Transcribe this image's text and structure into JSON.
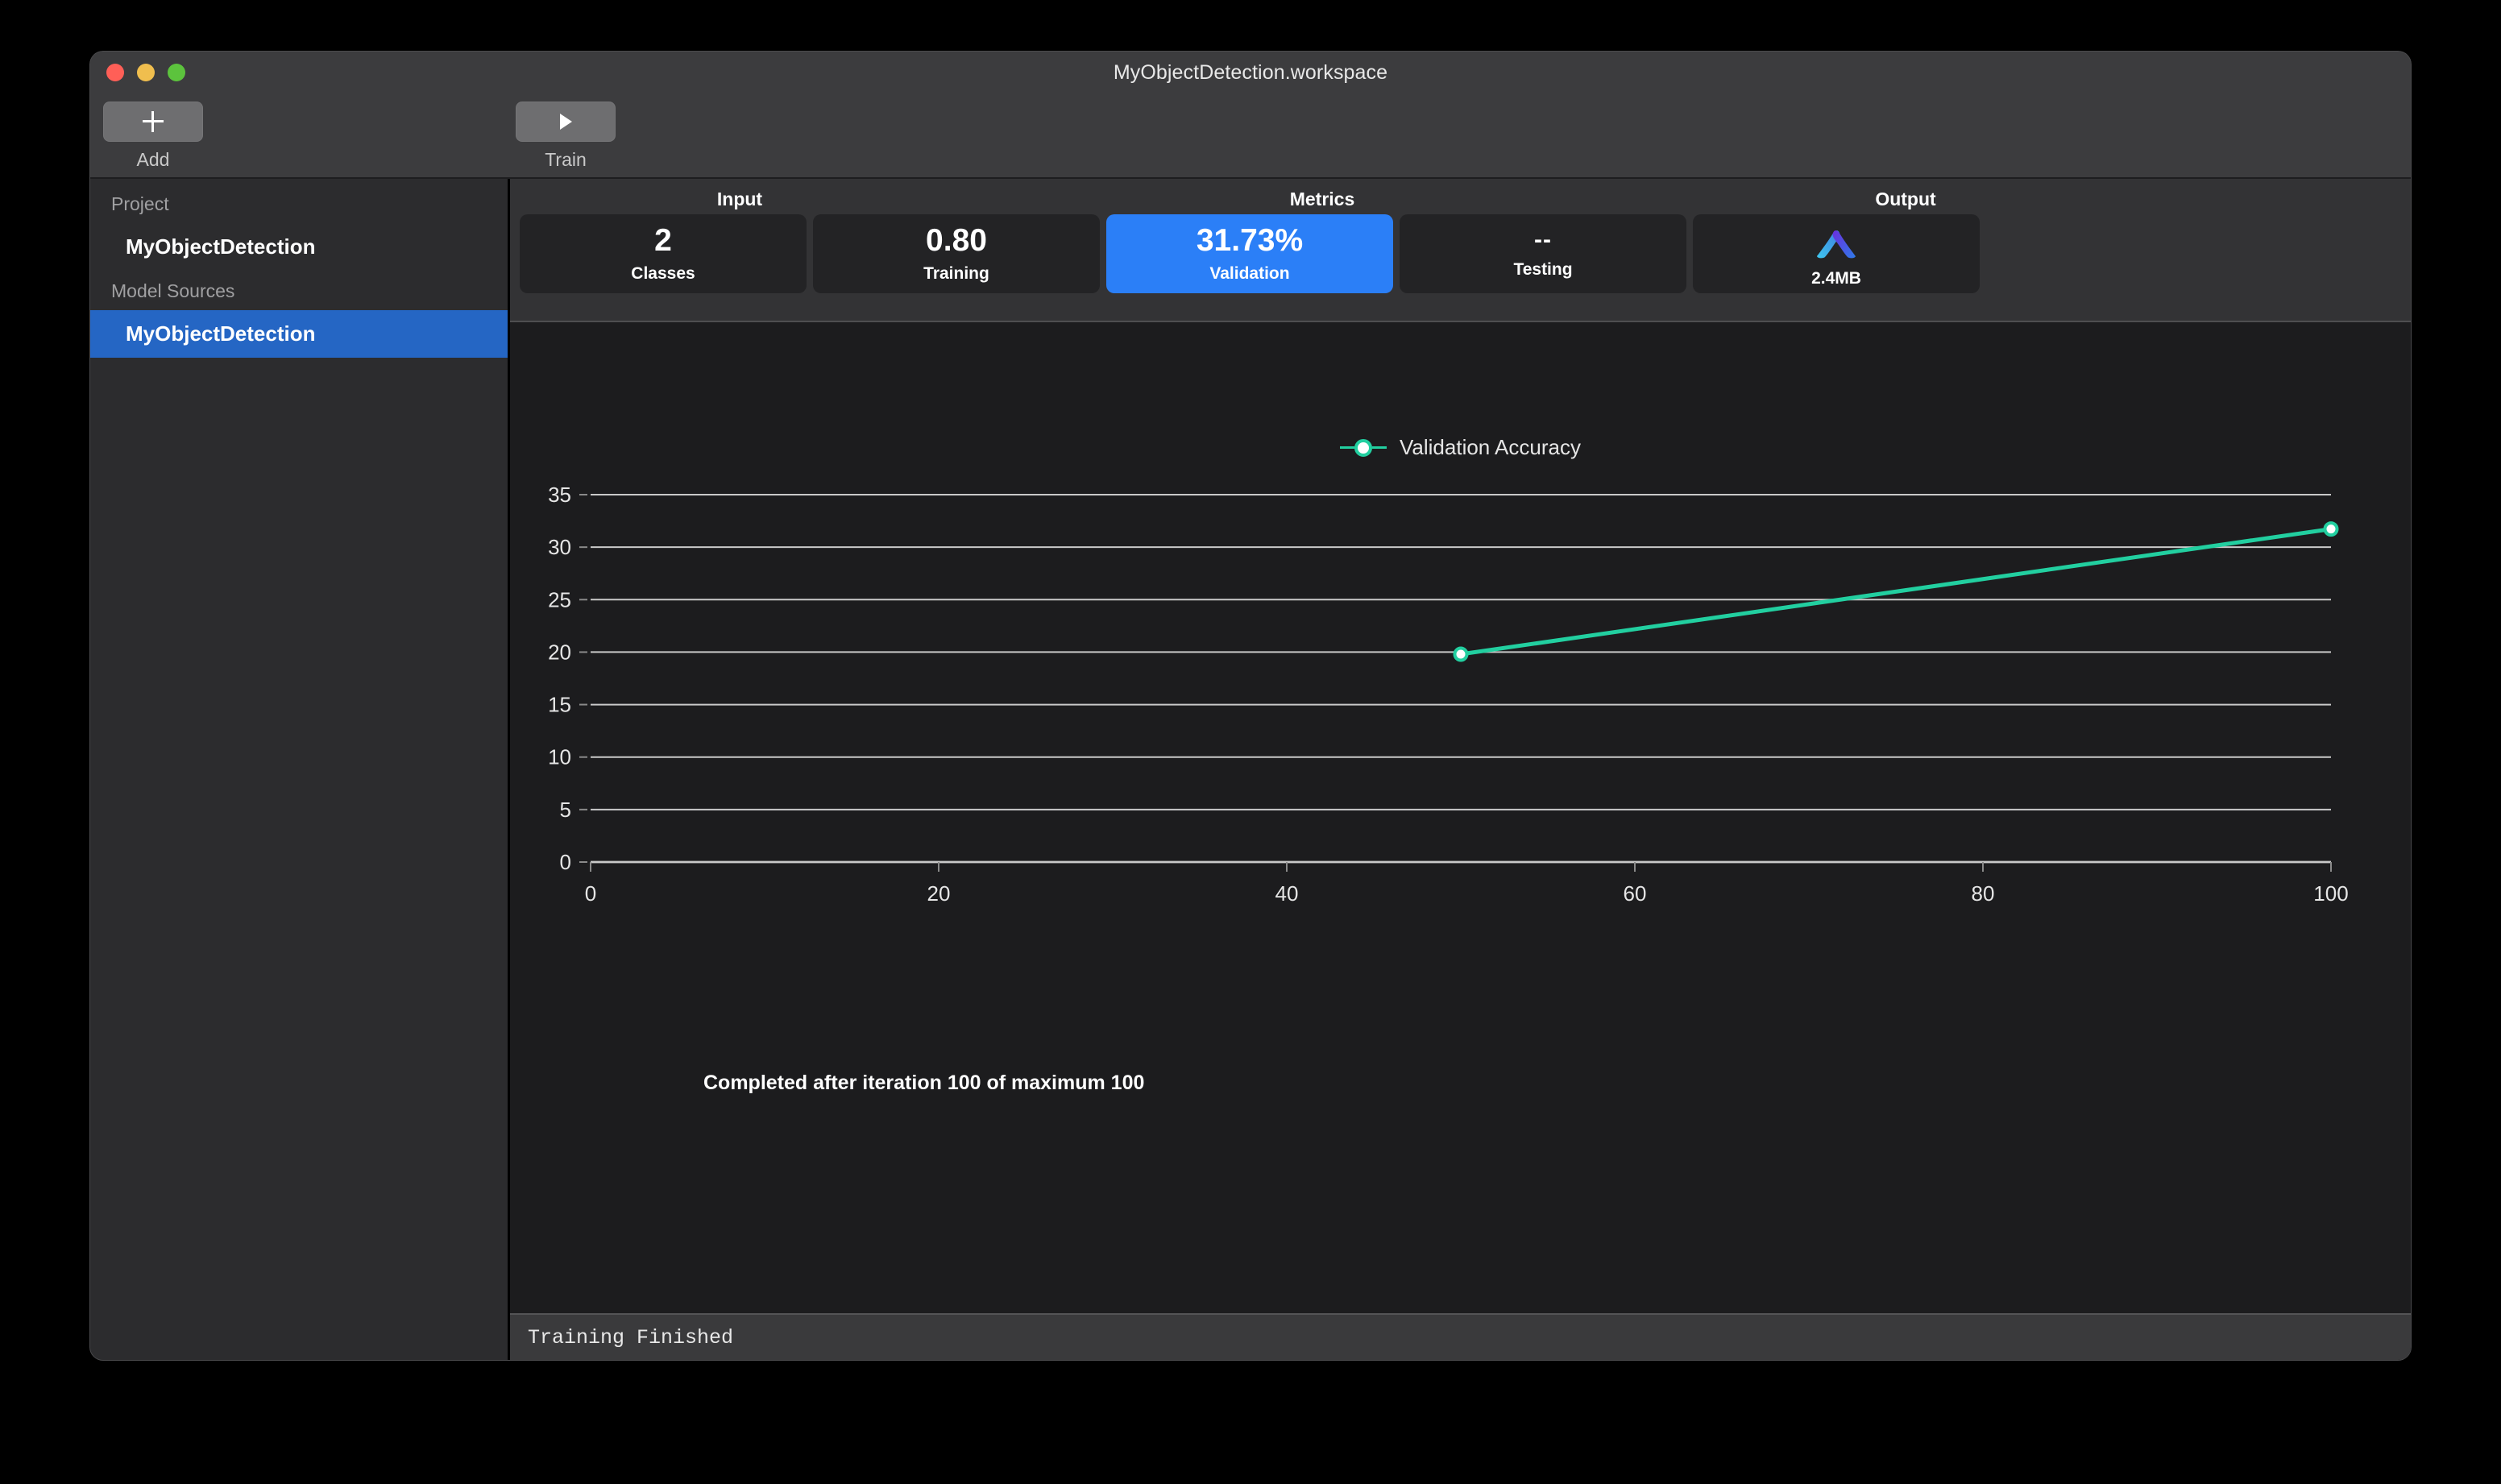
{
  "window": {
    "title": "MyObjectDetection.workspace",
    "traffic_lights": [
      "close",
      "minimize",
      "zoom"
    ]
  },
  "toolbar": {
    "items": [
      {
        "label": "Add",
        "icon": "plus-icon"
      },
      {
        "label": "Train",
        "icon": "play-icon"
      }
    ]
  },
  "sidebar": {
    "sections": [
      {
        "header": "Project",
        "items": [
          {
            "label": "MyObjectDetection",
            "selected": false
          }
        ]
      },
      {
        "header": "Model Sources",
        "items": [
          {
            "label": "MyObjectDetection",
            "selected": true
          }
        ]
      }
    ]
  },
  "metrics_header": {
    "groups": [
      {
        "title": "Input"
      },
      {
        "title": "Metrics"
      },
      {
        "title": "Output"
      }
    ],
    "cards": [
      {
        "value": "2",
        "label": "Classes",
        "accent": false
      },
      {
        "value": "0.80",
        "label": "Training",
        "accent": false
      },
      {
        "value": "31.73%",
        "label": "Validation",
        "accent": true
      },
      {
        "value": "--",
        "label": "Testing",
        "accent": false
      },
      {
        "value": "2.4MB",
        "label": "",
        "accent": false,
        "icon": "coreml-icon"
      }
    ]
  },
  "chart_data": {
    "type": "line",
    "title": "",
    "legend": [
      {
        "name": "Validation Accuracy",
        "color": "#22cfa0"
      }
    ],
    "legend_position": "top-center",
    "xlabel": "",
    "ylabel": "",
    "xlim": [
      0,
      100
    ],
    "ylim": [
      0,
      35
    ],
    "xticks": [
      0,
      20,
      40,
      60,
      80,
      100
    ],
    "yticks": [
      0,
      5,
      10,
      15,
      20,
      25,
      30,
      35
    ],
    "grid": true,
    "series": [
      {
        "name": "Validation Accuracy",
        "color": "#22cfa0",
        "x": [
          50,
          100
        ],
        "y": [
          19.8,
          31.73
        ],
        "markers": true
      }
    ]
  },
  "progress": {
    "completion_text": "Completed after iteration 100 of maximum 100"
  },
  "statusbar": {
    "text": "Training Finished"
  },
  "colors": {
    "accent_blue": "#2b7ff7",
    "selection_blue": "#2566c4",
    "series_teal": "#22cfa0",
    "window_chrome": "#3c3c3e",
    "sidebar_bg": "#2c2c2e",
    "card_bg": "#232325",
    "chart_bg": "#1c1c1e"
  }
}
